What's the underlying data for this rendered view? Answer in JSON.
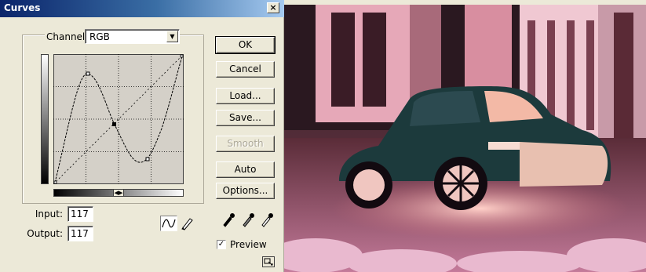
{
  "dialog": {
    "title": "Curves",
    "close_label": "×",
    "channel_label": "Channel:",
    "channel_value": "RGB",
    "input_label": "Input:",
    "input_value": "117",
    "output_label": "Output:",
    "output_value": "117",
    "buttons": {
      "ok": "OK",
      "cancel": "Cancel",
      "load": "Load...",
      "save": "Save...",
      "smooth": "Smooth",
      "auto": "Auto",
      "options": "Options..."
    },
    "preview_label": "Preview",
    "preview_checked": true
  },
  "colors": {
    "title_start": "#0a246a",
    "title_end": "#a6caf0",
    "dialog_bg": "#ece9d8"
  },
  "icons": [
    "close-icon",
    "dropdown-arrow-icon",
    "curve-tool-icon",
    "pencil-tool-icon",
    "black-eyedropper-icon",
    "gray-eyedropper-icon",
    "white-eyedropper-icon",
    "expand-dialog-icon"
  ]
}
